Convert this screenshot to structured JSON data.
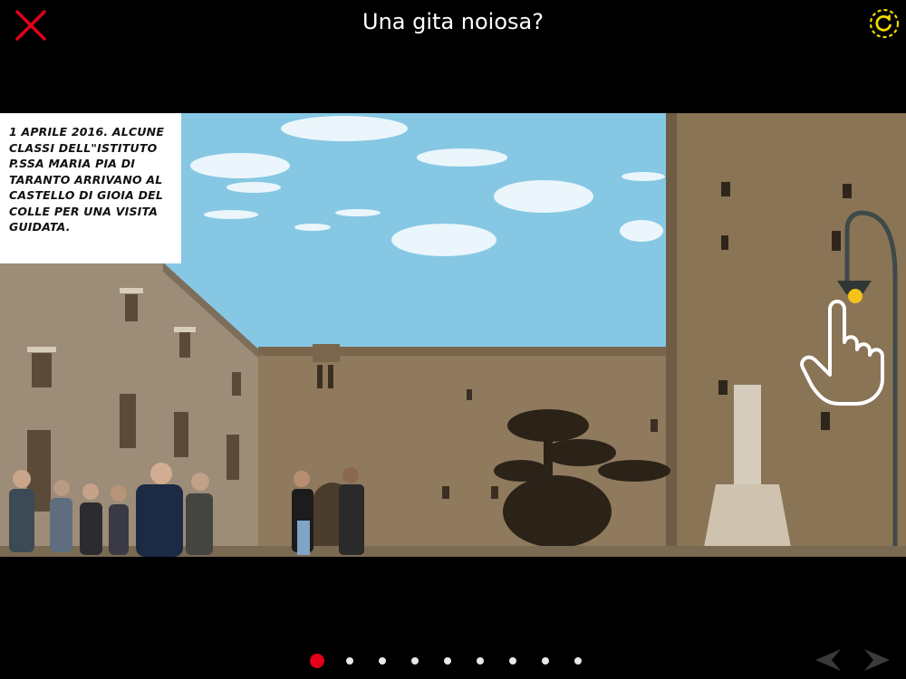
{
  "header": {
    "title": "Una gita noiosa?",
    "close_icon": "close-x-icon",
    "refresh_icon": "refresh-icon",
    "colors": {
      "close": "#e3001a",
      "refresh": "#f2d800"
    }
  },
  "caption": {
    "text": "1 APRILE 2016. ALCUNE CLASSI DELL\"ISTITUTO P.SSA MARIA PIA DI TARANTO ARRIVANO AL CASTELLO DI GIOIA DEL COLLE PER UNA VISITA GUIDATA."
  },
  "hotspot": {
    "icon": "pointing-hand-icon"
  },
  "pagination": {
    "total": 9,
    "current": 1,
    "active_color": "#e3001a",
    "inactive_color": "#e8e8e8"
  },
  "nav": {
    "prev_icon": "prev-arrow-icon",
    "next_icon": "next-arrow-icon"
  }
}
